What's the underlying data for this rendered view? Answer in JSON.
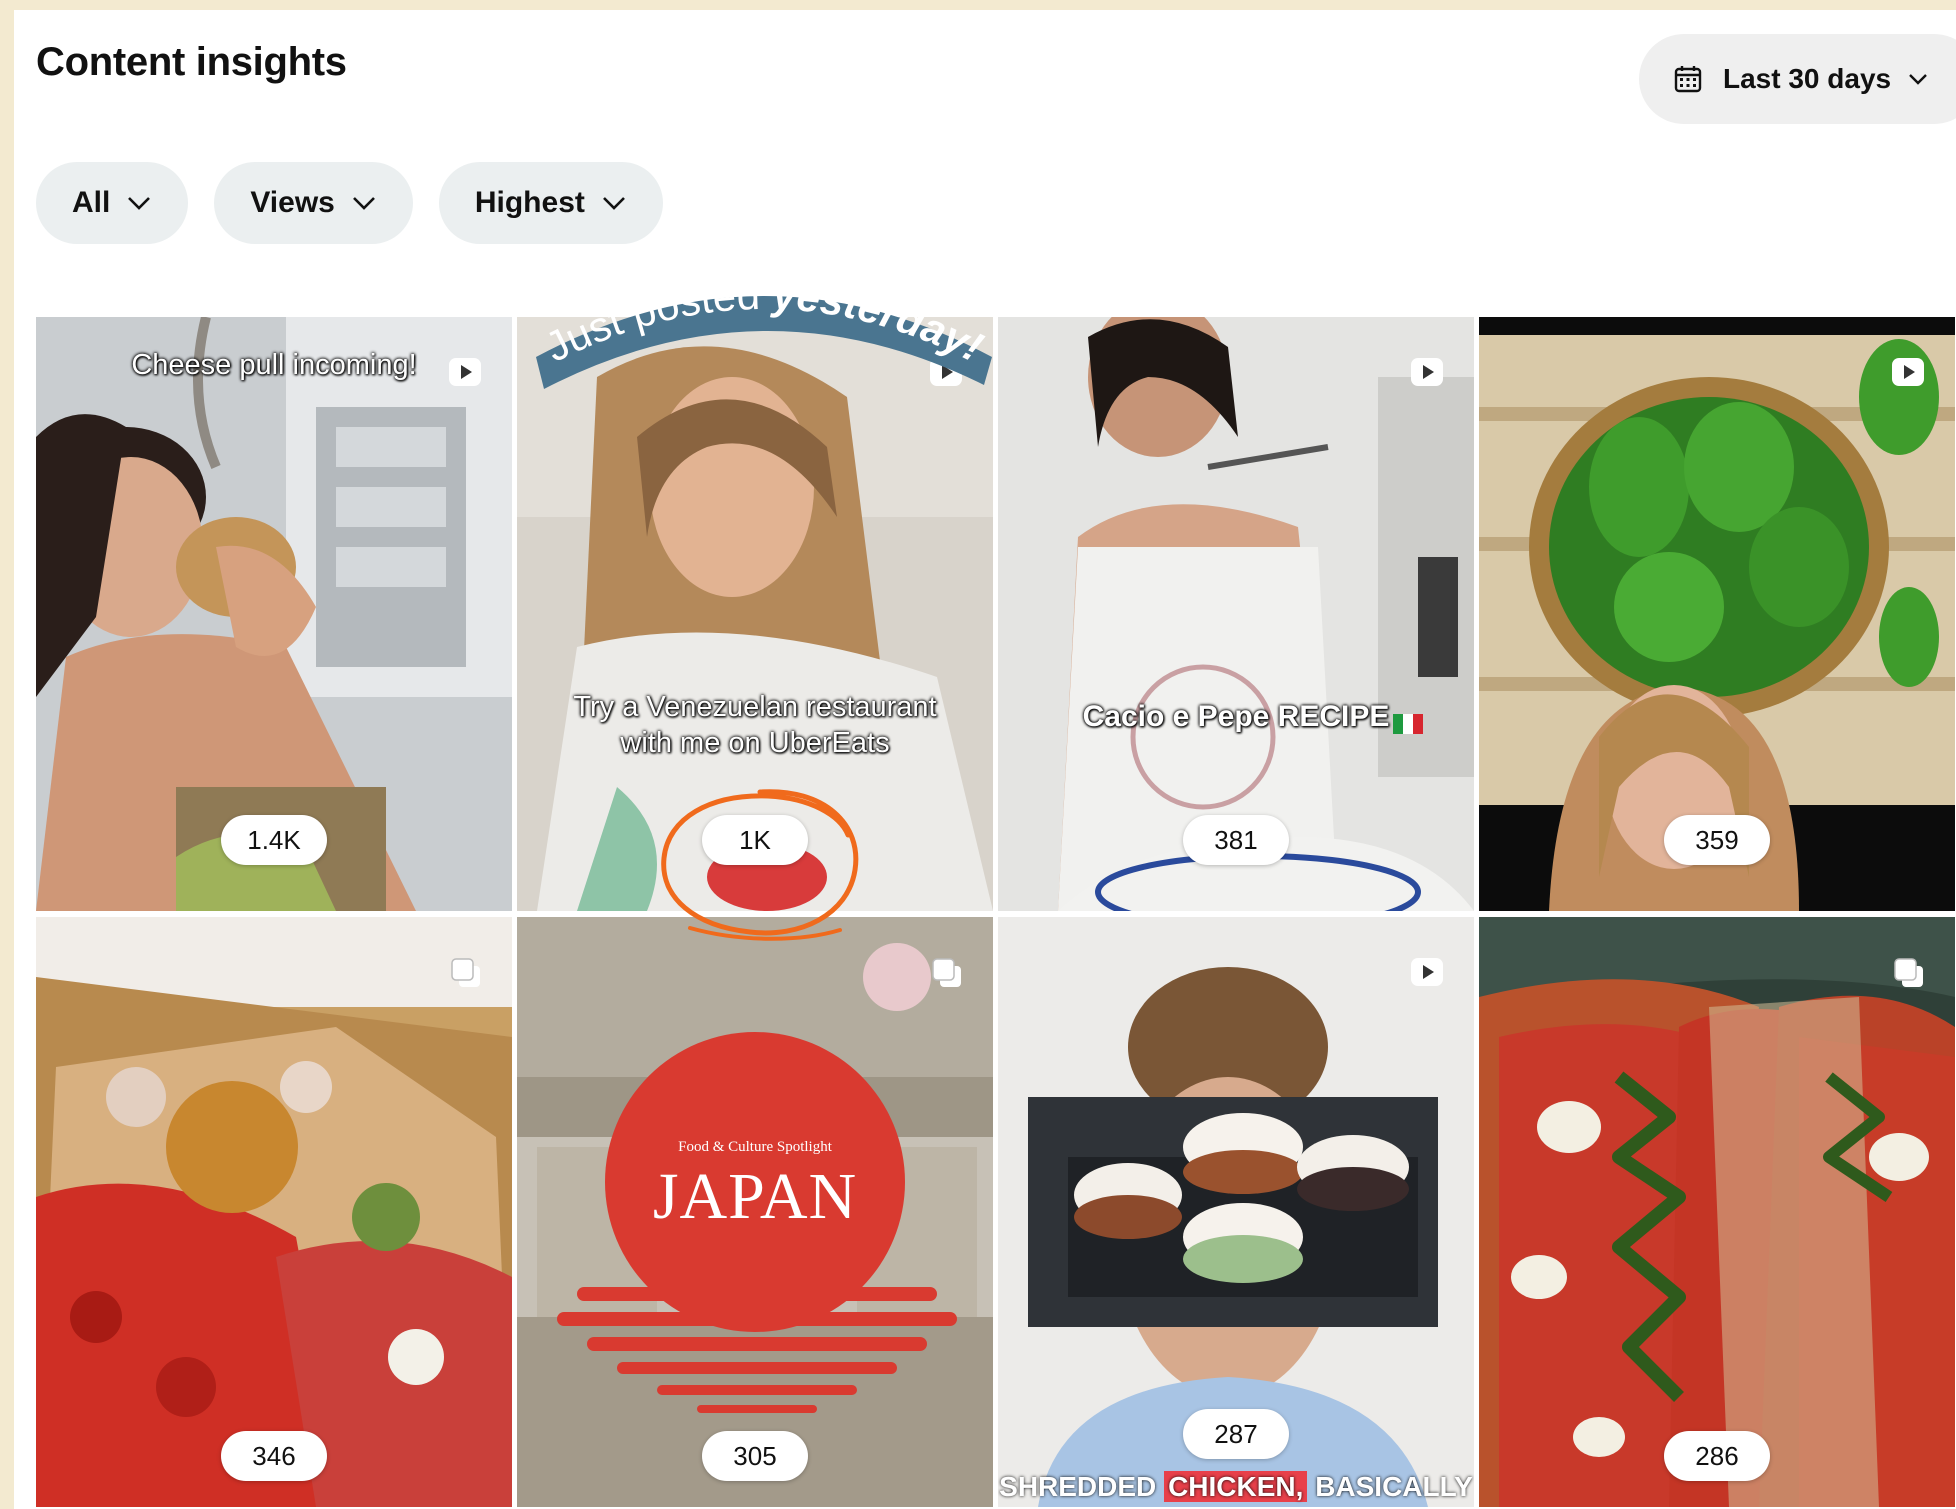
{
  "header": {
    "title": "Content insights",
    "date_range": {
      "label": "Last 30 days",
      "icon": "calendar-icon"
    }
  },
  "filters": [
    {
      "label": "All"
    },
    {
      "label": "Views"
    },
    {
      "label": "Highest"
    }
  ],
  "callout": {
    "text_plain": "Just posted ",
    "text_emphasis": "yesterday!"
  },
  "tiles": [
    {
      "views": "1.4K",
      "type": "video",
      "caption": "Cheese pull incoming!"
    },
    {
      "views": "1K",
      "type": "video",
      "caption_line1": "Try a Venezuelan restaurant",
      "caption_line2": "with me on UberEats",
      "highlighted": true
    },
    {
      "views": "381",
      "type": "video",
      "caption": "Cacio e Pepe RECIPE"
    },
    {
      "views": "359",
      "type": "video"
    },
    {
      "views": "346",
      "type": "carousel"
    },
    {
      "views": "305",
      "type": "carousel",
      "overlay_small": "Food & Culture Spotlight",
      "overlay_big": "JAPAN"
    },
    {
      "views": "287",
      "type": "video",
      "caption_w1": "SHREDDED",
      "caption_w2": "CHICKEN,",
      "caption_w3": "BASICALLY"
    },
    {
      "views": "286",
      "type": "carousel"
    }
  ],
  "colors": {
    "page_background": "#f3ead0",
    "pill_background": "#ebeff0",
    "callout_banner": "#4a7590",
    "annotation_orange": "#f06a1c",
    "japan_red": "#d93a30"
  }
}
